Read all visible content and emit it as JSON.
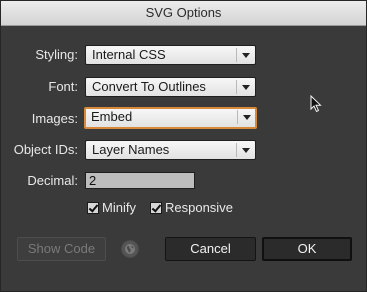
{
  "dialog": {
    "title": "SVG Options"
  },
  "fields": {
    "styling": {
      "label": "Styling:",
      "value": "Internal CSS"
    },
    "font": {
      "label": "Font:",
      "value": "Convert To Outlines"
    },
    "images": {
      "label": "Images:",
      "value": "Embed"
    },
    "object_ids": {
      "label": "Object IDs:",
      "value": "Layer Names"
    },
    "decimal": {
      "label": "Decimal:",
      "value": "2"
    }
  },
  "checkboxes": {
    "minify": {
      "label": "Minify",
      "checked": true
    },
    "responsive": {
      "label": "Responsive",
      "checked": true
    }
  },
  "buttons": {
    "show_code": "Show Code",
    "cancel": "Cancel",
    "ok": "OK"
  },
  "icons": {
    "web": "globe-icon",
    "cursor": "mouse-pointer-icon",
    "dropdown": "chevron-down-icon",
    "check": "checkmark-icon"
  },
  "colors": {
    "dialog_bg": "#3a3a3a",
    "focus_ring": "#d88a3a"
  }
}
